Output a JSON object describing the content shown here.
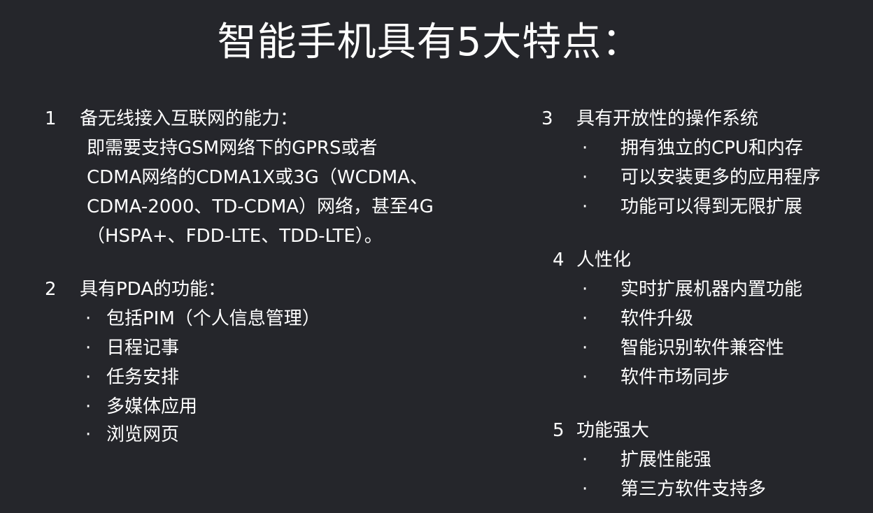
{
  "title": "智能手机具有5大特点：",
  "left": {
    "section1": {
      "number": "1",
      "heading": "备无线接入互联网的能力：",
      "desc_lines": [
        "即需要支持GSM网络下的GPRS或者",
        "CDMA网络的CDMA1X或3G（WCDMA、",
        "CDMA-2000、TD-CDMA）网络，甚至4G",
        "（HSPA+、FDD-LTE、TDD-LTE）。"
      ]
    },
    "section2": {
      "number": "2",
      "heading": "具有PDA的功能：",
      "bullet": "·",
      "items": [
        "包括PIM（个人信息管理）",
        "日程记事",
        "任务安排",
        "多媒体应用",
        "浏览网页"
      ]
    }
  },
  "right": {
    "section3": {
      "number": "3",
      "heading": "具有开放性的操作系统",
      "bullet": "·",
      "items": [
        "拥有独立的CPU和内存",
        "可以安装更多的应用程序",
        "功能可以得到无限扩展"
      ]
    },
    "section4": {
      "number": "4",
      "heading": "人性化",
      "bullet": "·",
      "items": [
        "实时扩展机器内置功能",
        "软件升级",
        "智能识别软件兼容性",
        "软件市场同步"
      ]
    },
    "section5": {
      "number": "5",
      "heading": "功能强大",
      "bullet": "·",
      "items": [
        "扩展性能强",
        "第三方软件支持多"
      ]
    }
  },
  "colors": {
    "background": "#25262b",
    "text": "#ffffff"
  }
}
